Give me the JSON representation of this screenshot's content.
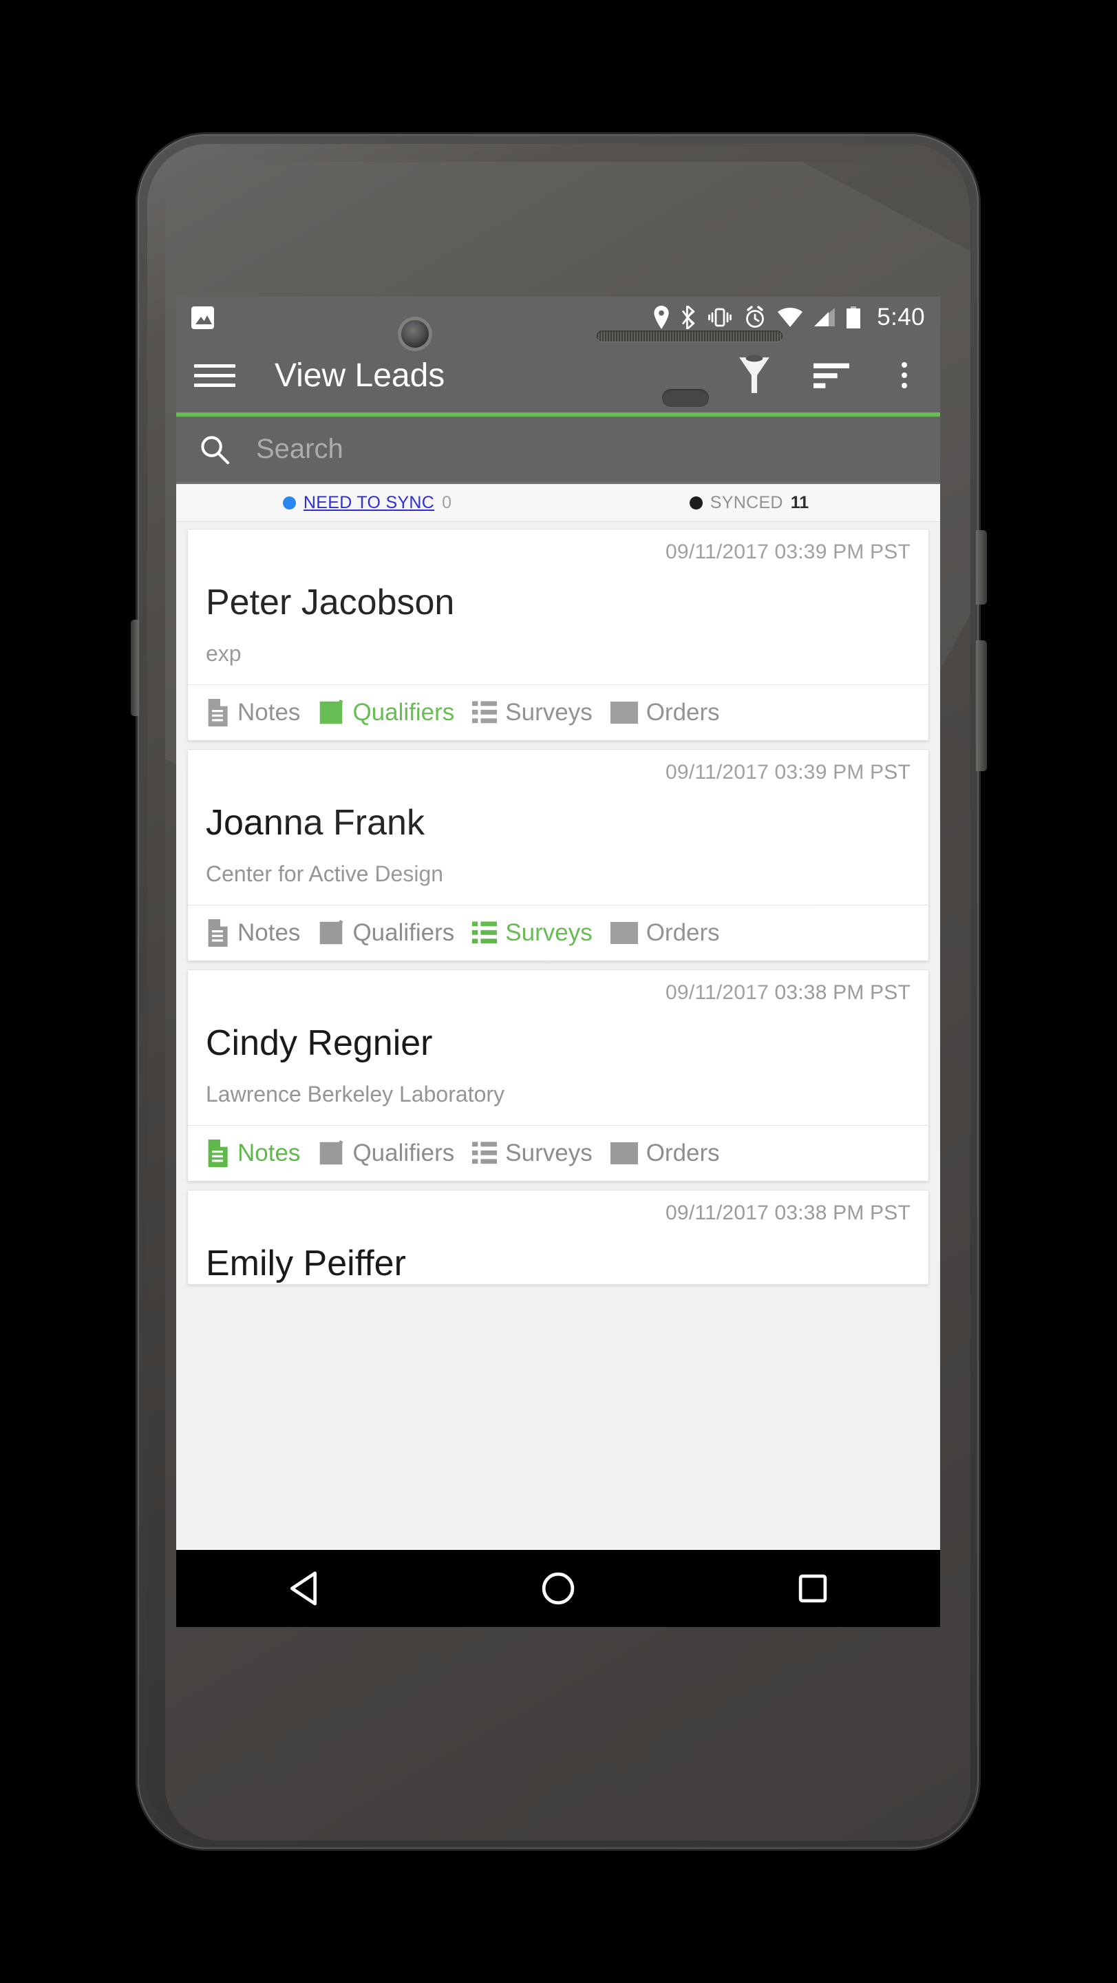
{
  "status_bar": {
    "notification_icon": "photo-icon",
    "icons": [
      "location-pin-icon",
      "bluetooth-icon",
      "vibrate-icon",
      "alarm-clock-icon",
      "wifi-icon",
      "cellular-signal-icon",
      "battery-icon"
    ],
    "clock": "5:40"
  },
  "app_bar": {
    "menu_icon": "hamburger-menu-icon",
    "title": "View Leads",
    "filter_icon": "filter-funnel-icon",
    "sort_icon": "sort-icon",
    "overflow_icon": "overflow-menu-icon"
  },
  "accent_color": "#5fb94a",
  "search": {
    "icon": "search-icon",
    "placeholder": "Search",
    "value": ""
  },
  "sync_tabs": [
    {
      "dot_color": "#1c7ff2",
      "label": "NEED TO SYNC",
      "count": "0",
      "selected": false,
      "style": "link"
    },
    {
      "dot_color": "#101010",
      "label": "SYNCED",
      "count": "11",
      "selected": true,
      "style": "plain"
    }
  ],
  "action_labels": {
    "notes": "Notes",
    "qualifiers": "Qualifiers",
    "surveys": "Surveys",
    "orders": "Orders"
  },
  "leads": [
    {
      "timestamp": "09/11/2017  03:39 PM PST",
      "name": "Peter Jacobson",
      "company": "exp",
      "active_action": "Qualifiers"
    },
    {
      "timestamp": "09/11/2017  03:39 PM PST",
      "name": "Joanna Frank",
      "company": "Center for Active Design",
      "active_action": "Surveys"
    },
    {
      "timestamp": "09/11/2017  03:38 PM PST",
      "name": "Cindy Regnier",
      "company": "Lawrence Berkeley Laboratory",
      "active_action": "Notes"
    },
    {
      "timestamp": "09/11/2017  03:38 PM PST",
      "name": "Emily Peiffer",
      "company": "",
      "active_action": ""
    }
  ],
  "nav_bar": {
    "back_icon": "back-triangle-icon",
    "home_icon": "home-circle-icon",
    "recents_icon": "recents-square-icon"
  }
}
